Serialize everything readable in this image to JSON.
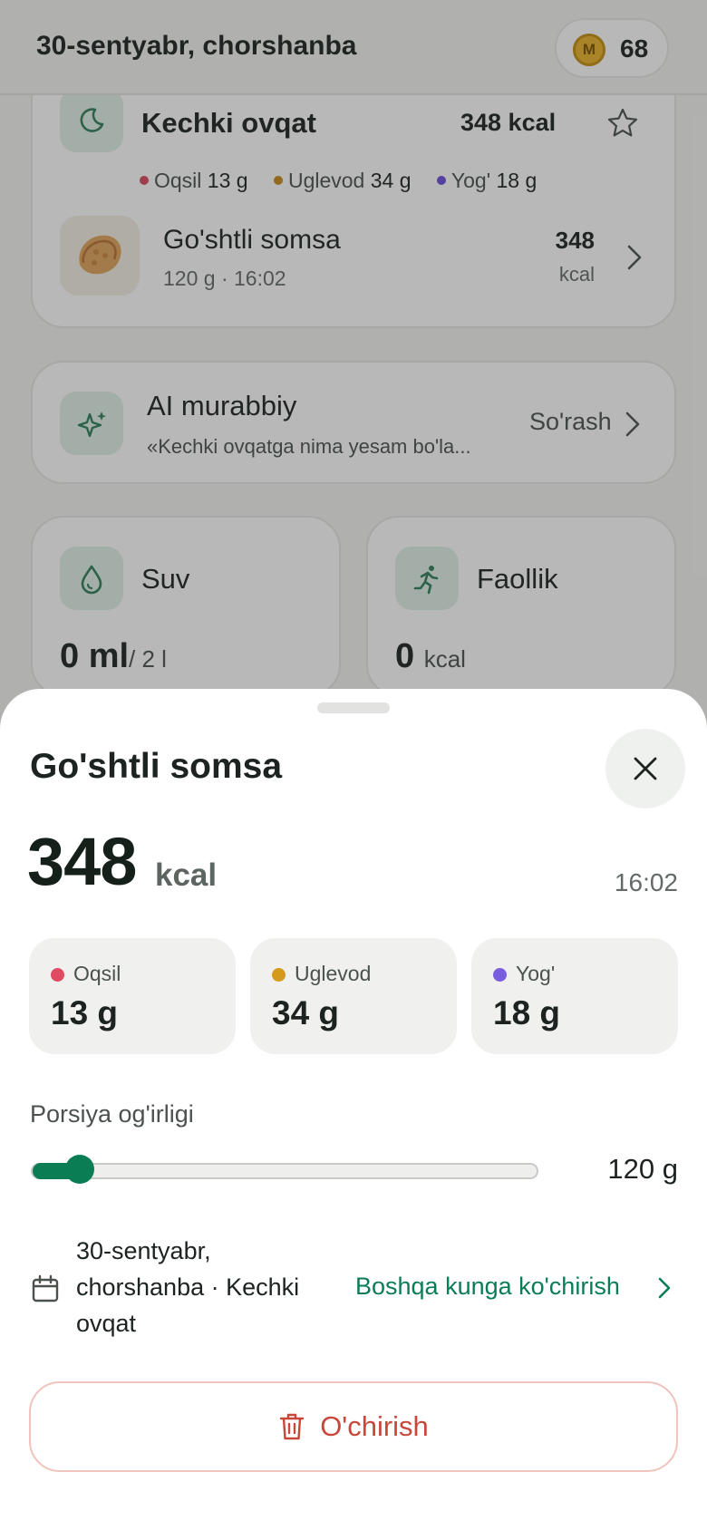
{
  "header": {
    "date_title": "30-sentyabr, chorshanba",
    "coin_count": "68",
    "coin_icon": "coin-icon",
    "coin_letter": "M"
  },
  "meal": {
    "name": "Kechki ovqat",
    "kcal": "348 kcal",
    "macros": [
      {
        "label": "Oqsil",
        "value": "13 g",
        "color": "#d9485f"
      },
      {
        "label": "Uglevod",
        "value": "34 g",
        "color": "#c88a16"
      },
      {
        "label": "Yog'",
        "value": "18 g",
        "color": "#6b4fd8"
      }
    ],
    "food": {
      "name": "Go'shtli somsa",
      "sub": "120 g · 16:02",
      "kcal_num": "348",
      "kcal_unit": "kcal"
    }
  },
  "ai": {
    "title": "AI murabbiy",
    "sub": "«Kechki ovqatga nima yesam bo'la...",
    "link": "So'rash"
  },
  "stats": {
    "water": {
      "title": "Suv",
      "value": "0 ml",
      "goal": "/ 2 l"
    },
    "activity": {
      "title": "Faollik",
      "value": "0",
      "unit": "kcal"
    }
  },
  "sheet": {
    "title": "Go'shtli somsa",
    "kcal": "348",
    "kcal_unit": "kcal",
    "time": "16:02",
    "macros": [
      {
        "label": "Oqsil",
        "value": "13 g",
        "color": "#df4b63"
      },
      {
        "label": "Uglevod",
        "value": "34 g",
        "color": "#d49a1c"
      },
      {
        "label": "Yog'",
        "value": "18 g",
        "color": "#7a5ce0"
      }
    ],
    "portion_label": "Porsiya og'irligi",
    "portion_value": "120 g",
    "portion_fraction": 0.1,
    "date_meal": "30-sentyabr, chorshanba · Kechki ovqat",
    "move_link": "Boshqa kunga ko'chirish",
    "delete_label": "O'chirish"
  },
  "colors": {
    "accent": "#0b7d55",
    "danger": "#c9473a"
  }
}
